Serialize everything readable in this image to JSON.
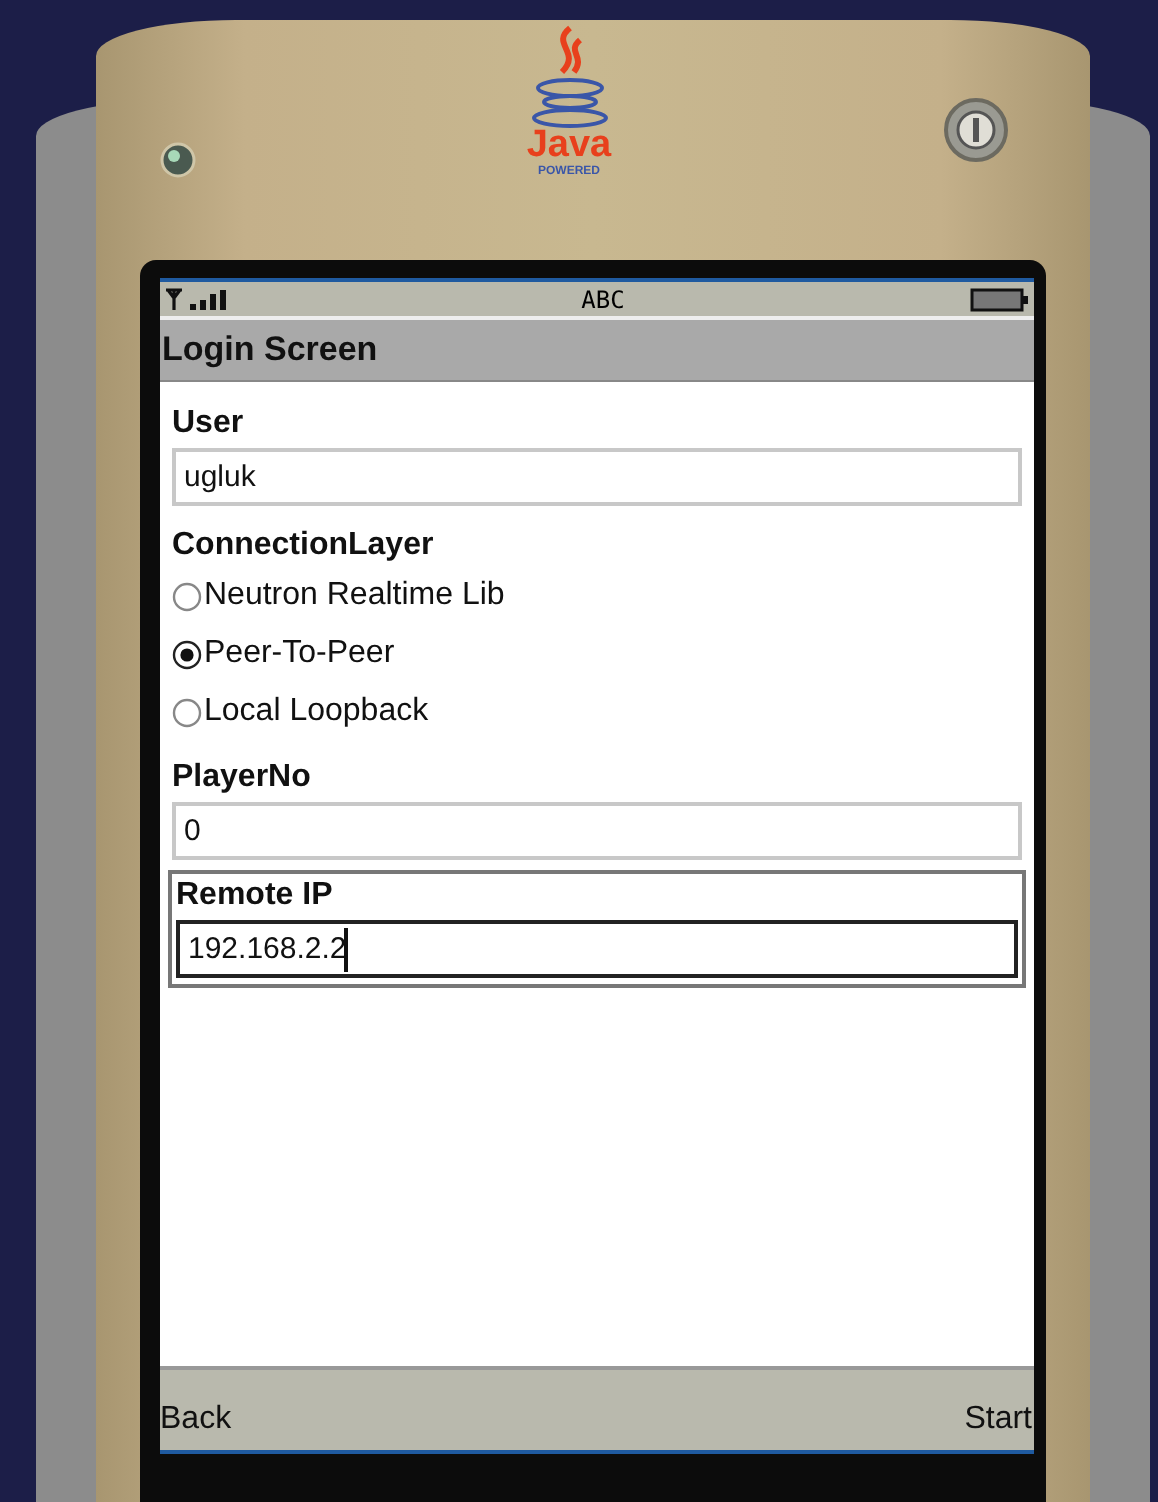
{
  "logo": {
    "text": "Java",
    "subtext": "POWERED"
  },
  "status_bar": {
    "input_mode": "ABC"
  },
  "title": "Login Screen",
  "user": {
    "label": "User",
    "value": "ugluk"
  },
  "connection_layer": {
    "label": "ConnectionLayer",
    "options": [
      {
        "label": "Neutron Realtime Lib",
        "selected": false
      },
      {
        "label": "Peer-To-Peer",
        "selected": true
      },
      {
        "label": "Local Loopback",
        "selected": false
      }
    ]
  },
  "player_no": {
    "label": "PlayerNo",
    "value": "0"
  },
  "remote_ip": {
    "label": "Remote IP",
    "value": "192.168.2.2",
    "focused": true
  },
  "softkeys": {
    "left": "Back",
    "right": "Start"
  }
}
